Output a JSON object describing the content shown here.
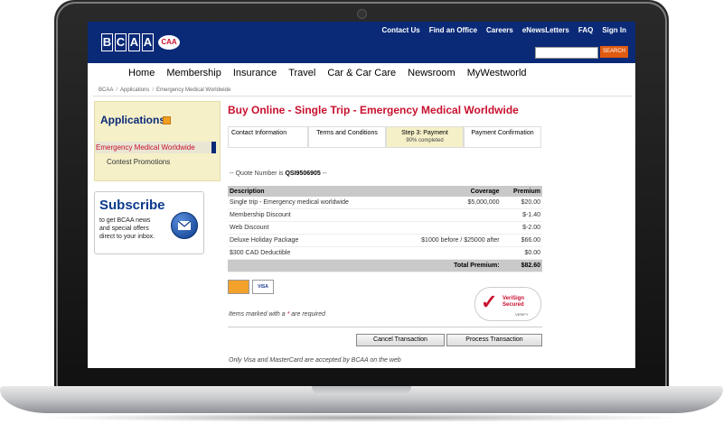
{
  "header": {
    "logo_text": "BCAA",
    "logo_caa": "CAA",
    "top_links": [
      "Contact Us",
      "Find an Office",
      "Careers",
      "eNewsLetters",
      "FAQ",
      "Sign In"
    ],
    "search_button": "SEARCH"
  },
  "nav": [
    "Home",
    "Membership",
    "Insurance",
    "Travel",
    "Car & Car Care",
    "Newsroom",
    "MyWestworld"
  ],
  "breadcrumb": [
    "BCAA",
    "Applications",
    "Emergency Medical Worldwide"
  ],
  "sidebar": {
    "title": "Applications",
    "active_item": "Emergency Medical Worldwide",
    "item": "Contest Promotions",
    "subscribe_title": "Subscribe",
    "subscribe_text": [
      "to get BCAA news",
      "and special offers",
      "direct to your inbox."
    ]
  },
  "main": {
    "title": "Buy Online - Single Trip - Emergency Medical Worldwide",
    "steps": [
      {
        "label": "Contact Information",
        "sub": ""
      },
      {
        "label": "Terms and Conditions",
        "sub": ""
      },
      {
        "label": "Step 3: Payment",
        "sub": "90% completed"
      },
      {
        "label": "Payment Confirmation",
        "sub": ""
      }
    ],
    "quote_prefix": "-- Quote Number is",
    "quote_number": "QSI9506905",
    "quote_suffix": "--",
    "table_headers": [
      "Description",
      "Coverage",
      "Premium"
    ],
    "rows": [
      {
        "desc": "Single trip - Emergency medical worldwide",
        "coverage": "$5,000,000",
        "premium": "$20.00"
      },
      {
        "desc": "Membership Discount",
        "coverage": "",
        "premium": "$-1.40"
      },
      {
        "desc": "Web Discount",
        "coverage": "",
        "premium": "$-2.00"
      },
      {
        "desc": "Deluxe Holiday Package",
        "coverage": "$1000 before / $25000 after",
        "premium": "$66.00"
      },
      {
        "desc": "$300 CAD Deductible",
        "coverage": "",
        "premium": "$0.00"
      }
    ],
    "total_label": "Total Premium:",
    "total_value": "$82.60",
    "card_mc": "MasterCard",
    "card_visa": "VISA",
    "verisign_line1": "VeriSign",
    "verisign_line2": "Secured",
    "verisign_verify": "VERIFY",
    "required_prefix": "Items marked with a",
    "required_star": "*",
    "required_suffix": "are required",
    "cancel_button": "Cancel Transaction",
    "process_button": "Process Transaction",
    "visa_note": "Only Visa and MasterCard are accepted by BCAA on the web"
  }
}
